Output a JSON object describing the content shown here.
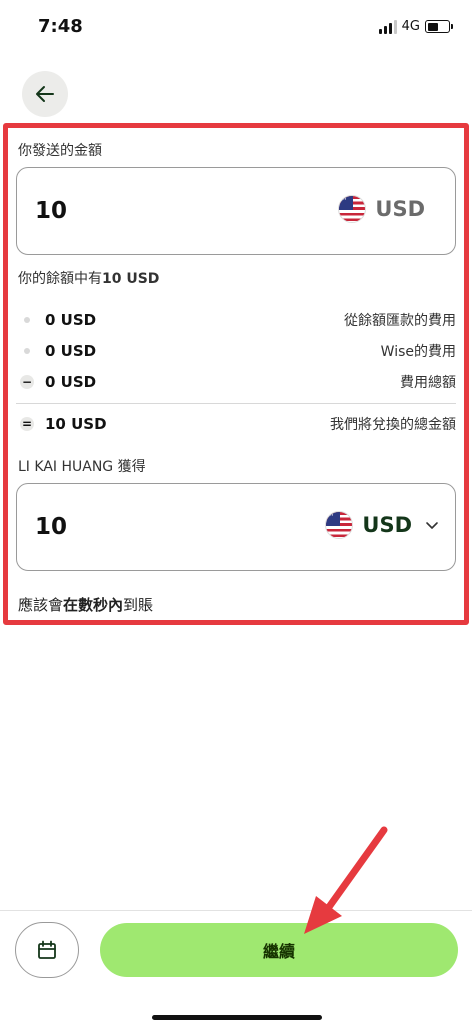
{
  "status_bar": {
    "time": "7:48",
    "network": "4G"
  },
  "send": {
    "label": "你發送的金額",
    "amount": "10",
    "currency": "USD",
    "balance_note_prefix": "你的餘額中有",
    "balance_note_amount": "10 USD"
  },
  "fees": [
    {
      "marker": "dot",
      "amount": "0 USD",
      "desc": "從餘額匯款的費用"
    },
    {
      "marker": "dot",
      "amount": "0 USD",
      "desc": "Wise的費用"
    },
    {
      "marker": "−",
      "amount": "0 USD",
      "desc": "費用總額"
    }
  ],
  "converted": {
    "marker": "=",
    "amount": "10 USD",
    "desc": "我們將兌換的總金額"
  },
  "receive": {
    "label": "LI KAI HUANG 獲得",
    "amount": "10",
    "currency": "USD"
  },
  "arrival": {
    "prefix": "應該會",
    "emphasis": "在數秒內",
    "suffix": "到賬"
  },
  "actions": {
    "continue_label": "繼續"
  },
  "icons": {
    "back": "arrow-left-icon",
    "schedule": "calendar-icon",
    "currency_flag": "us-flag-icon",
    "currency_dropdown": "chevron-down-icon"
  },
  "colors": {
    "accent_button": "#9fe870",
    "button_text": "#163300",
    "annotation_red": "#e63a3f"
  }
}
